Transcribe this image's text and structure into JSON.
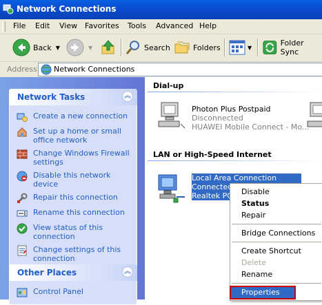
{
  "window": {
    "title": "Network Connections"
  },
  "menu": [
    "File",
    "Edit",
    "View",
    "Favorites",
    "Tools",
    "Advanced",
    "Help"
  ],
  "toolbar": {
    "back_label": "Back",
    "search_label": "Search",
    "folders_label": "Folders",
    "folder_sync_label": "Folder Sync"
  },
  "address": {
    "label": "Address",
    "value": "Network Connections"
  },
  "network_tasks": {
    "title": "Network Tasks",
    "items": [
      {
        "label": "Create a new connection",
        "icon": "new-connection-icon"
      },
      {
        "label": "Set up a home or small office network",
        "icon": "home-network-icon"
      },
      {
        "label": "Change Windows Firewall settings",
        "icon": "firewall-icon"
      },
      {
        "label": "Disable this network device",
        "icon": "disable-device-icon"
      },
      {
        "label": "Repair this connection",
        "icon": "repair-icon"
      },
      {
        "label": "Rename this connection",
        "icon": "rename-icon"
      },
      {
        "label": "View status of this connection",
        "icon": "status-icon"
      },
      {
        "label": "Change settings of this connection",
        "icon": "settings-icon"
      }
    ]
  },
  "other_places": {
    "title": "Other Places",
    "items": [
      {
        "label": "Control Panel",
        "icon": "control-panel-icon"
      }
    ]
  },
  "dialup": {
    "heading": "Dial-up",
    "connection": {
      "name": "Photon Plus Postpaid",
      "status": "Disconnected",
      "device": "HUAWEI Mobile Connect - Mo..."
    }
  },
  "lan": {
    "heading": "LAN or High-Speed Internet",
    "connection": {
      "name": "Local Area Connection",
      "status": "Connected",
      "device": "Realtek PC"
    }
  },
  "context_menu": {
    "items": [
      "Disable",
      "Status",
      "Repair",
      "Bridge Connections",
      "Create Shortcut",
      "Delete",
      "Rename",
      "Properties"
    ],
    "default_item": "Status",
    "disabled_item": "Delete",
    "highlighted_item": "Properties"
  },
  "colors": {
    "titlebar": "#0a49c8",
    "task_link": "#215dc6",
    "selection": "#316ac5",
    "highlight_border": "#cc0000"
  }
}
